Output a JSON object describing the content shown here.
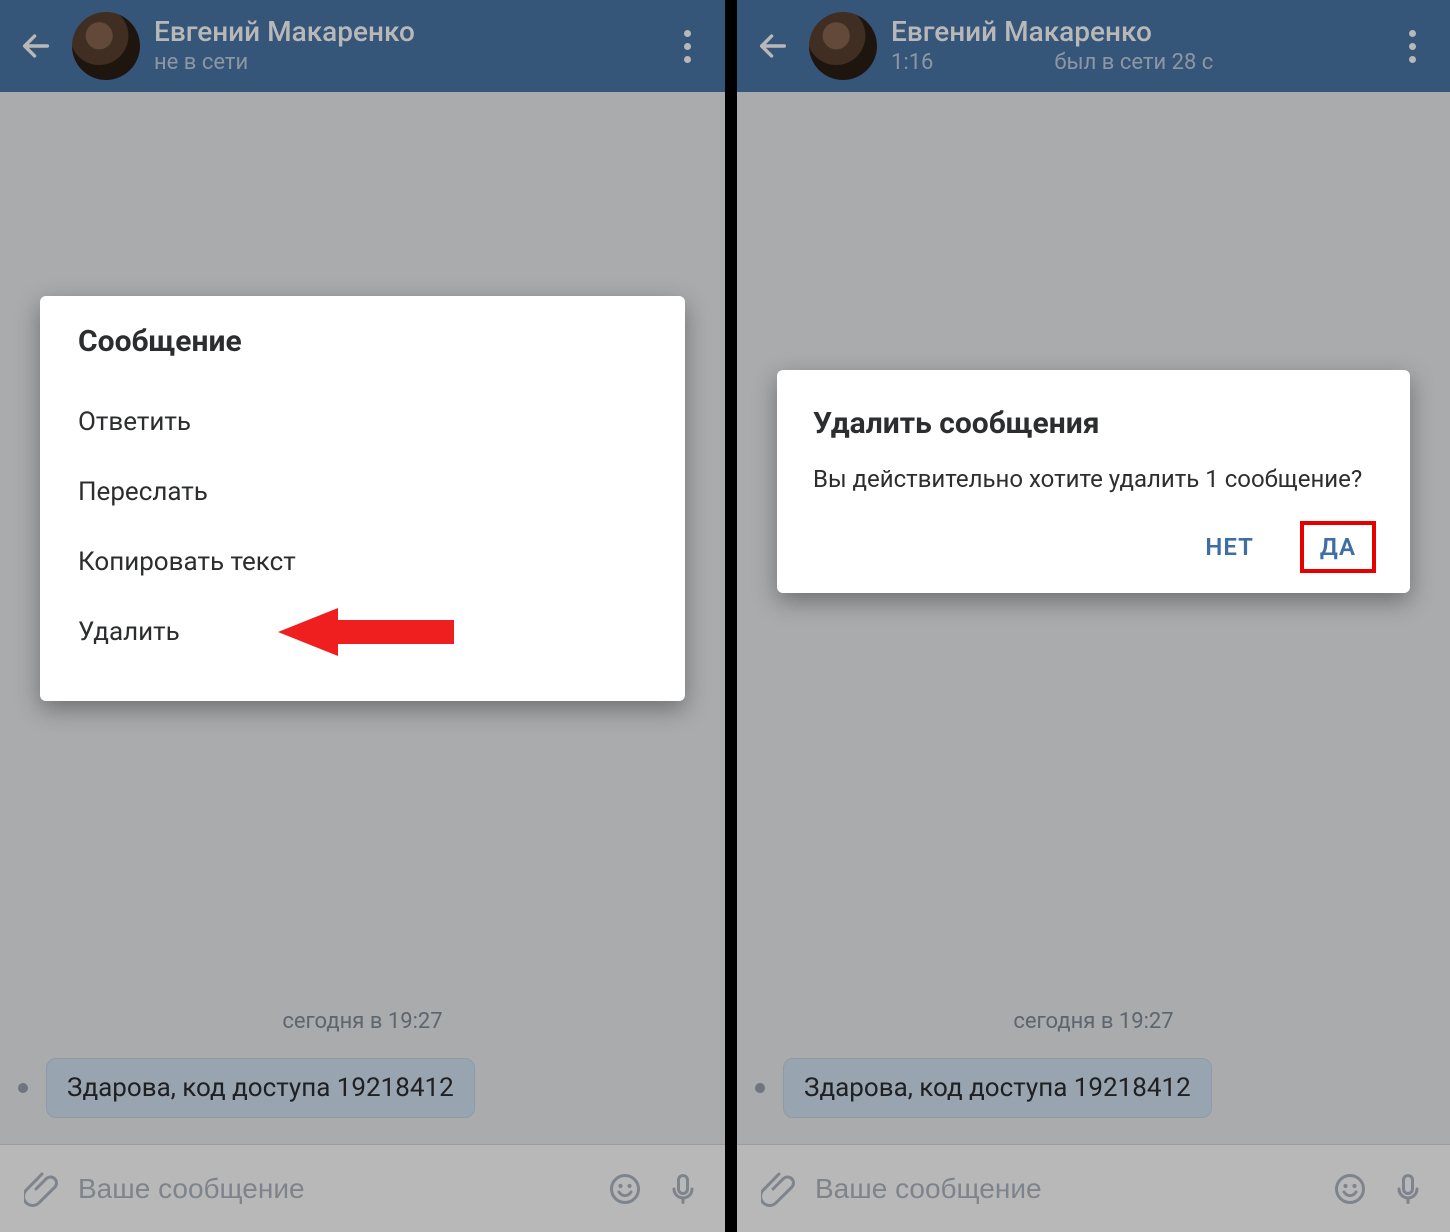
{
  "left": {
    "header": {
      "name": "Евгений Макаренко",
      "status": "не в сети"
    },
    "chat": {
      "timestamp": "сегодня в 19:27",
      "message_text": "Здарова, код доступа 19218412"
    },
    "compose": {
      "placeholder": "Ваше сообщение"
    },
    "menu": {
      "title": "Сообщение",
      "items": [
        "Ответить",
        "Переслать",
        "Копировать текст",
        "Удалить"
      ]
    }
  },
  "right": {
    "header": {
      "name": "Евгений Макаренко",
      "status_time": "1:16",
      "status": "был в сети 28 с"
    },
    "chat": {
      "timestamp": "сегодня в 19:27",
      "message_text": "Здарова, код доступа 19218412"
    },
    "compose": {
      "placeholder": "Ваше сообщение"
    },
    "dialog": {
      "title": "Удалить сообщения",
      "body": "Вы действительно хотите удалить 1 сообщение?",
      "no": "НЕТ",
      "yes": "ДА"
    }
  },
  "icons": {
    "back": "back-arrow-icon",
    "kebab": "more-vert-icon",
    "attach": "attach-icon",
    "emoji": "emoji-icon",
    "mic": "mic-icon"
  }
}
